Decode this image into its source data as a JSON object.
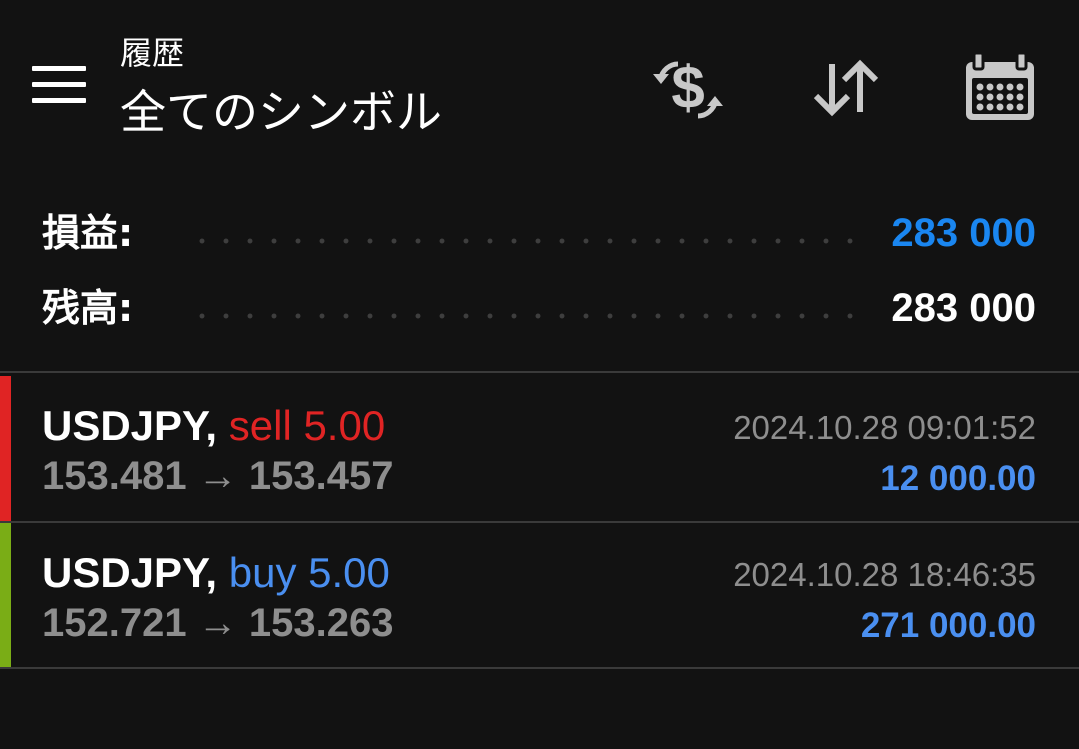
{
  "header": {
    "subtitle": "履歴",
    "title": "全てのシンボル",
    "icons": [
      "menu-icon",
      "currency-exchange-icon",
      "sort-icon",
      "calendar-icon"
    ]
  },
  "summary": {
    "profit_label": "損益:",
    "profit_value": "283 000",
    "balance_label": "残高:",
    "balance_value": "283 000"
  },
  "deals": [
    {
      "symbol": "USDJPY,",
      "type_volume": "sell 5.00",
      "open_price": "153.481",
      "arrow": "→",
      "close_price": "153.457",
      "time": "2024.10.28 09:01:52",
      "profit": "12 000.00"
    },
    {
      "symbol": "USDJPY,",
      "type_volume": "buy 5.00",
      "open_price": "152.721",
      "arrow": "→",
      "close_price": "153.263",
      "time": "2024.10.28 18:46:35",
      "profit": "271 000.00"
    }
  ],
  "colors": {
    "background": "#121212",
    "accent_blue": "#1a86f0",
    "profit_blue": "#4a8ff0",
    "sell_red": "#e02424",
    "buy_green": "#7aad16",
    "muted_gray": "#8e8e8e",
    "divider": "#3a3a3a",
    "icon_gray": "#c8c8c8"
  }
}
